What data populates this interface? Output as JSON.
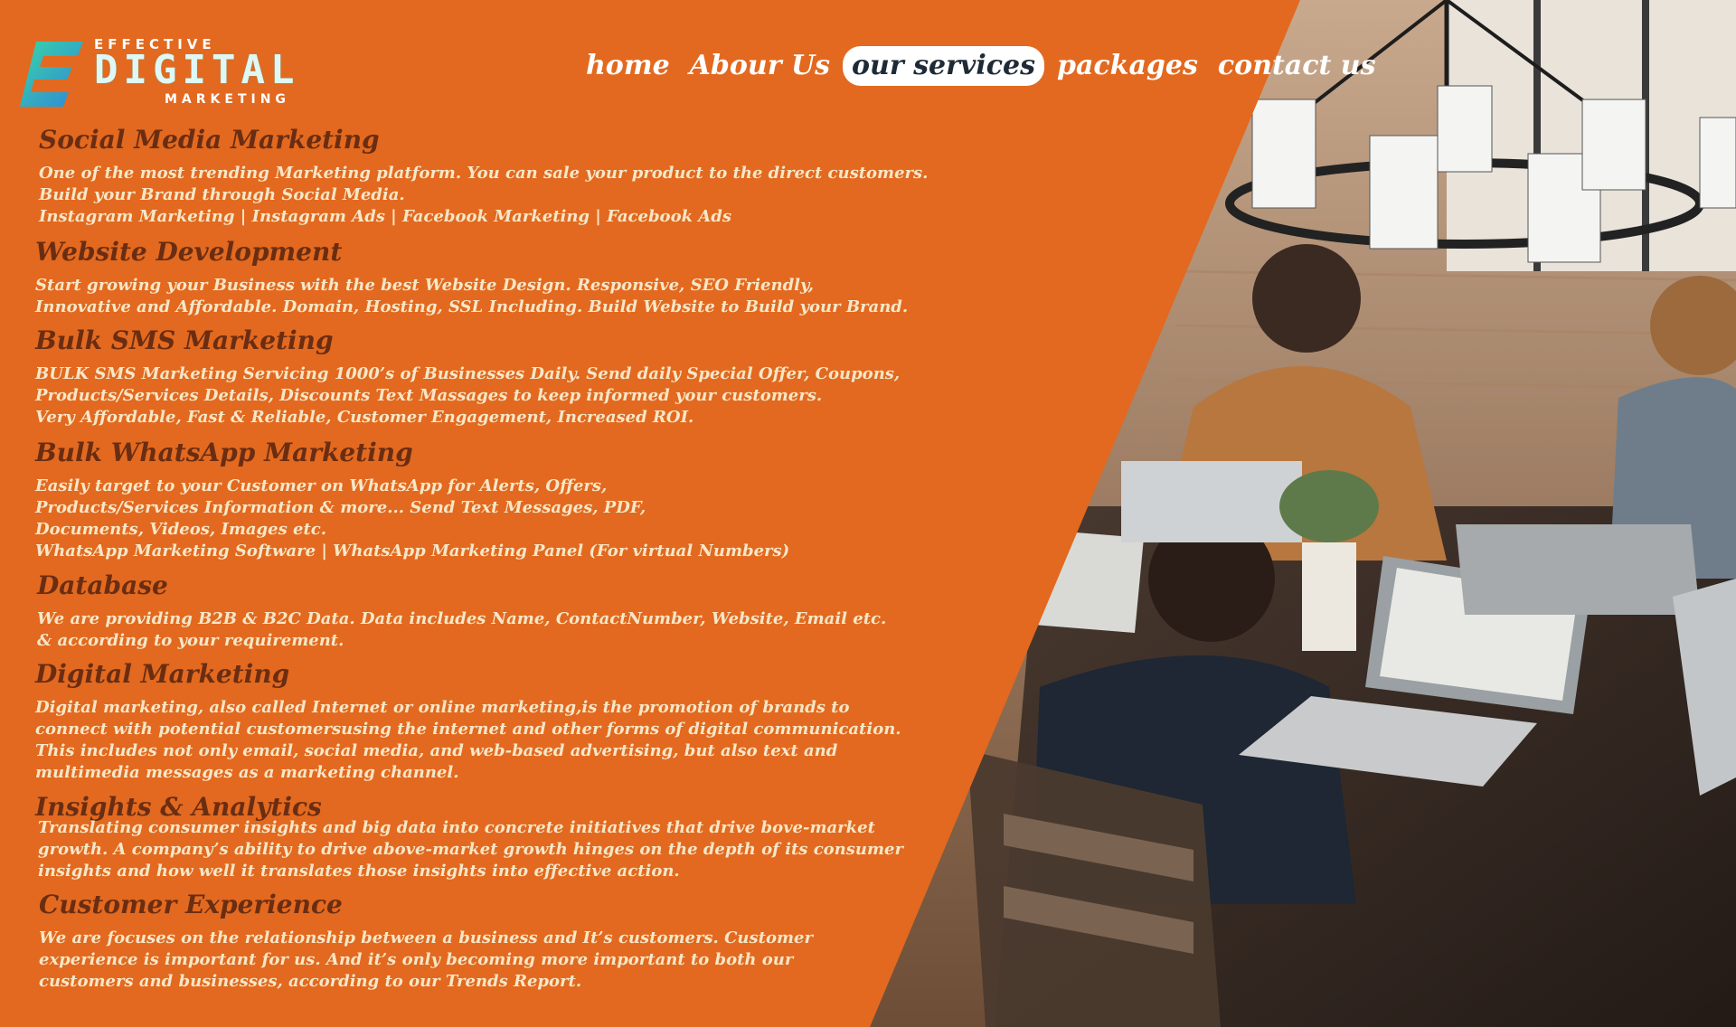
{
  "logo": {
    "top": "EFFECTIVE",
    "middle": "DIGITAL",
    "bottom": "MARKETING"
  },
  "nav": {
    "items": [
      "home",
      "Abour Us",
      "our services",
      "packages",
      "contact us"
    ],
    "active": "our services"
  },
  "services": [
    {
      "title": "Social Media Marketing",
      "description": "One of the most trending Marketing platform. You can sale your product to the direct customers.\nBuild your Brand through Social Media.\nInstagram Marketing | Instagram Ads | Facebook Marketing | Facebook Ads"
    },
    {
      "title": "Website Development",
      "description": "Start growing your Business with the best Website Design. Responsive, SEO Friendly,\nInnovative and Affordable. Domain, Hosting, SSL Including. Build Website to Build your Brand."
    },
    {
      "title": "Bulk SMS Marketing",
      "description": "BULK SMS Marketing Servicing 1000’s of Businesses Daily. Send daily Special Offer, Coupons,\nProducts/Services Details, Discounts Text Massages to keep informed your customers.\nVery Affordable, Fast & Reliable, Customer Engagement, Increased ROI."
    },
    {
      "title": "Bulk WhatsApp Marketing",
      "description": "Easily target to your Customer on WhatsApp for Alerts, Offers,\nProducts/Services Information & more... Send Text Messages, PDF,\nDocuments, Videos, Images etc.\nWhatsApp Marketing Software | WhatsApp Marketing Panel (For virtual Numbers)"
    },
    {
      "title": "Database",
      "description": "We are providing B2B & B2C Data. Data includes Name, ContactNumber, Website, Email etc.\n& according to your requirement."
    },
    {
      "title": "Digital Marketing",
      "description": "Digital marketing, also called Internet or online marketing,is the promotion of brands to\nconnect with potential customersusing the internet and other forms of digital communication.\nThis includes not only email, social media, and web-based advertising, but also text and\nmultimedia messages as a marketing channel."
    },
    {
      "title": "Insights & Analytics",
      "description": "Translating consumer insights and big data into concrete initiatives that drive bove-market\ngrowth. A company’s ability to drive above-market growth hinges on the depth of its consumer\ninsights and how well it translates those insights into effective action."
    },
    {
      "title": "Customer Experience",
      "description": "We are focuses on the relationship between a business and It’s customers. Customer\nexperience is important for us. And it’s only becoming more important to both our\ncustomers and businesses, according to our Trends Report."
    }
  ],
  "colors": {
    "panel": "#e2691f",
    "heading": "#6a2d12",
    "body_text": "#f6e7c8",
    "nav_text": "#ffffff",
    "logo_teal": "#38c6b8"
  }
}
